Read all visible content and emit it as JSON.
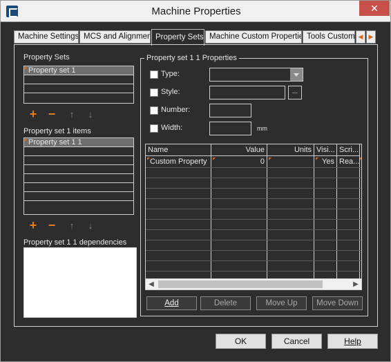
{
  "window": {
    "title": "Machine Properties",
    "close_glyph": "✕"
  },
  "tabs": [
    {
      "label": "Machine Settings"
    },
    {
      "label": "MCS and Alignment"
    },
    {
      "label": "Property Sets"
    },
    {
      "label": "Machine Custom Properties"
    },
    {
      "label": "Tools Custom P"
    }
  ],
  "tab_scroll": {
    "left_glyph": "◀",
    "right_glyph": "▶"
  },
  "property_sets": {
    "label": "Property Sets",
    "items": [
      "Property set 1"
    ]
  },
  "items_section": {
    "label": "Property set 1 items",
    "items": [
      "Property set 1 1"
    ]
  },
  "dependencies": {
    "label": "Property set 1 1 dependencies"
  },
  "toolbar": {
    "plus": "+",
    "minus": "−",
    "up": "↑",
    "down": "↓"
  },
  "properties": {
    "group_title": "Property set 1 1 Properties",
    "type_label": "Type:",
    "style_label": "Style:",
    "style_button": "...",
    "number_label": "Number:",
    "width_label": "Width:",
    "width_unit": "mm"
  },
  "grid": {
    "columns": [
      "Name",
      "Value",
      "Units",
      "Visi...",
      "Scri..."
    ],
    "rows": [
      {
        "name": "Custom Property",
        "value": "0",
        "units": "",
        "visible": "Yes",
        "script": "Rea..."
      }
    ],
    "scroll_left": "◀",
    "scroll_right": "▶"
  },
  "grid_buttons": {
    "add": "Add",
    "delete": "Delete",
    "move_up": "Move Up",
    "move_down": "Move Down"
  },
  "footer": {
    "ok": "OK",
    "cancel": "Cancel",
    "help": "Help"
  },
  "icons": {
    "app": "app-logo-icon",
    "close": "close-icon"
  },
  "colors": {
    "accent": "#e87d1e",
    "background": "#2d2d2d",
    "selection": "#6e6e6e",
    "close": "#c7504b"
  }
}
